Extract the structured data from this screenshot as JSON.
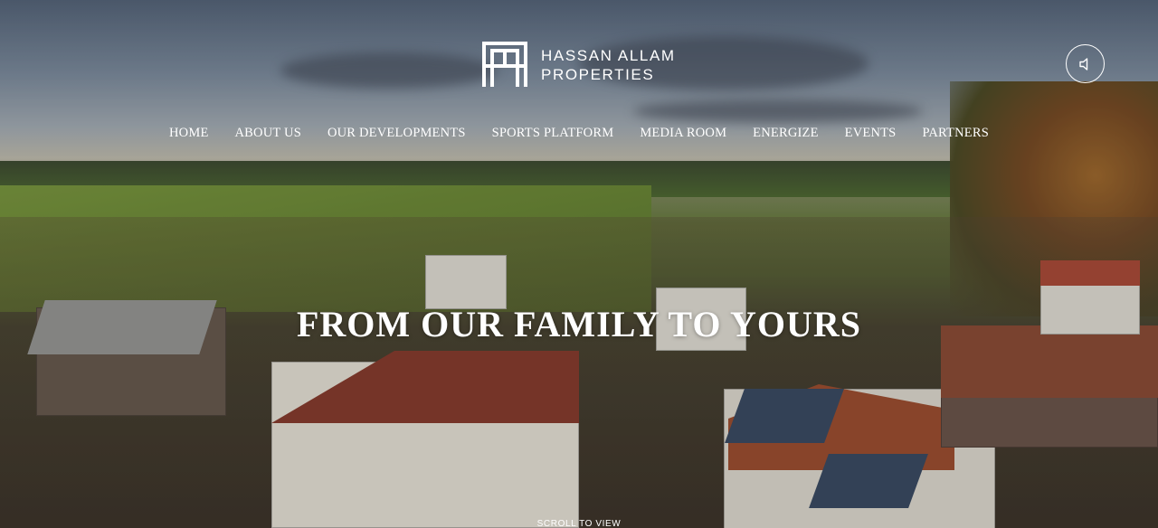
{
  "brand": {
    "line1": "HASSAN ALLAM",
    "line2": "PROPERTIES",
    "logo_icon": "ha-monogram-icon"
  },
  "sound": {
    "icon": "speaker-icon"
  },
  "nav": {
    "items": [
      "HOME",
      "ABOUT US",
      "OUR DEVELOPMENTS",
      "SPORTS PLATFORM",
      "MEDIA ROOM",
      "ENERGIZE",
      "EVENTS",
      "PARTNERS"
    ]
  },
  "hero": {
    "headline": "FROM OUR FAMILY TO YOURS",
    "scroll_label": "SCROLL TO VIEW"
  },
  "colors": {
    "text": "#ffffff"
  }
}
